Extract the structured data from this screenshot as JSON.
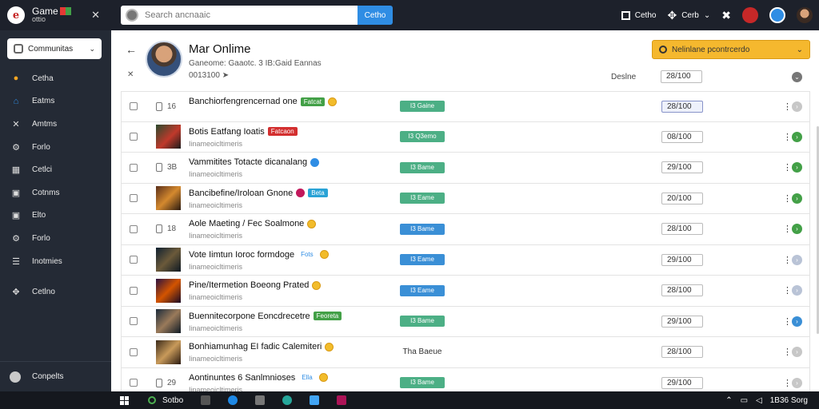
{
  "brand": {
    "name": "Game",
    "sub": "ottio"
  },
  "search": {
    "placeholder": "Search ancnaaic",
    "button": "Cetho"
  },
  "top_actions": {
    "item1": "Cetho",
    "item2": "Cerb"
  },
  "sidebar": {
    "community": "Communitas",
    "items": [
      {
        "label": "Cetha",
        "icon": "circle-icon"
      },
      {
        "label": "Eatms",
        "icon": "home-icon"
      },
      {
        "label": "Amtms",
        "icon": "cross-icon"
      },
      {
        "label": "Forlo",
        "icon": "gear-icon"
      },
      {
        "label": "Cetlci",
        "icon": "grid-icon"
      },
      {
        "label": "Cotnms",
        "icon": "image-icon"
      },
      {
        "label": "Elto",
        "icon": "image-icon"
      },
      {
        "label": "Forlo",
        "icon": "gear-icon"
      },
      {
        "label": "Inotmies",
        "icon": "list-icon"
      },
      {
        "label": "Cetlno",
        "icon": "puzzle-icon"
      }
    ],
    "bottom": "Conpelts"
  },
  "profile": {
    "name": "Mar Onlime",
    "meta": "Ganeome: Gaaotc. 3 IB:Gaid Eannas",
    "sub": "0013100",
    "action": "Nelinlane pcontrcerdo",
    "header_label": "Deslne",
    "header_time": "28/100"
  },
  "rows": [
    {
      "title": "Banchiorfengrencernad one",
      "subtitle": "",
      "mark": "16",
      "thumb": "",
      "tags": [
        {
          "text": "Fatcat",
          "color": "#43a047"
        }
      ],
      "emoji": true,
      "status": "I3 Gaine",
      "status_color": "#4caf85",
      "time": "28/100",
      "selected": true,
      "circle": "#c7c7c7"
    },
    {
      "title": "Botis Eatfang Ioatis",
      "subtitle": "Iinameoicltimeris",
      "mark": "",
      "thumb": "game1",
      "tags": [
        {
          "text": "Fatcaon",
          "color": "#d32f2f"
        }
      ],
      "emoji": false,
      "status": "I3 Q3emo",
      "status_color": "#4caf85",
      "time": "08/100",
      "selected": false,
      "circle": "#43a047"
    },
    {
      "title": "Vammitites Totacte dicanalang",
      "subtitle": "Iinameoicltimeris",
      "mark": "3B",
      "thumb": "",
      "tags": [
        {
          "text": "",
          "color": "#2f8de4",
          "round": true
        }
      ],
      "emoji": false,
      "status": "I3 Bame",
      "status_color": "#4caf85",
      "time": "29/100",
      "selected": false,
      "circle": "#43a047"
    },
    {
      "title": "Bancibefine/Iroloan Gnone",
      "subtitle": "Iinameoicltimeris",
      "mark": "",
      "thumb": "game2",
      "tags": [
        {
          "text": "",
          "color": "#c2185b",
          "round": true
        },
        {
          "text": "Beta",
          "color": "#29a3d6"
        }
      ],
      "emoji": false,
      "status": "I3 Eame",
      "status_color": "#4caf85",
      "time": "20/100",
      "selected": false,
      "circle": "#43a047"
    },
    {
      "title": "Aole Maeting / Fec Soalmone",
      "subtitle": "Iinameoicltimeris",
      "mark": "18",
      "thumb": "",
      "tags": [],
      "emoji": true,
      "status": "I3 Bame",
      "status_color": "#3a8fd6",
      "time": "28/100",
      "selected": false,
      "circle": "#43a047"
    },
    {
      "title": "Vote Iimtun Ioroc formdoge",
      "subtitle": "Iinameoicltimeris",
      "mark": "",
      "thumb": "game3",
      "tags": [
        {
          "text": "Fots",
          "color": "#ffffff",
          "text_color": "#2f8de4"
        }
      ],
      "emoji": true,
      "status": "I3 Eame",
      "status_color": "#3a8fd6",
      "time": "29/100",
      "selected": false,
      "circle": "#b9c3d6"
    },
    {
      "title": "Pine/Itermetion Boeong Prated",
      "subtitle": "Iinameoicltimeris",
      "mark": "",
      "thumb": "game4",
      "tags": [],
      "emoji": true,
      "status": "I3 Eame",
      "status_color": "#3a8fd6",
      "time": "28/100",
      "selected": false,
      "circle": "#b9c3d6"
    },
    {
      "title": "Buennitecorpone Eoncdrecetre",
      "subtitle": "Iinameoicltimeris",
      "mark": "",
      "thumb": "game5",
      "tags": [
        {
          "text": "Feoreta",
          "color": "#43a047"
        }
      ],
      "emoji": false,
      "status": "I3 Bame",
      "status_color": "#4caf85",
      "time": "29/100",
      "selected": false,
      "circle": "#3a8fd6"
    },
    {
      "title": "Bonhiamunhag EI fadic Calemiteri",
      "subtitle": "Iinameoicltimeris",
      "mark": "",
      "thumb": "game6",
      "tags": [],
      "emoji": true,
      "status": "Tha Baeue",
      "status_color": "",
      "time": "28/100",
      "selected": false,
      "circle": "#c7c7c7"
    },
    {
      "title": "Aontinuntes 6 Sanlmnioses",
      "subtitle": "Iinameoicltimeris",
      "mark": "29",
      "thumb": "",
      "tags": [
        {
          "text": "Ella",
          "color": "#ffffff",
          "text_color": "#2f8de4"
        }
      ],
      "emoji": true,
      "status": "I3 Bame",
      "status_color": "#4caf85",
      "time": "29/100",
      "selected": false,
      "circle": "#c7c7c7"
    }
  ],
  "taskbar": {
    "search": "Sotbo",
    "clock": "1B36 Sorg"
  }
}
